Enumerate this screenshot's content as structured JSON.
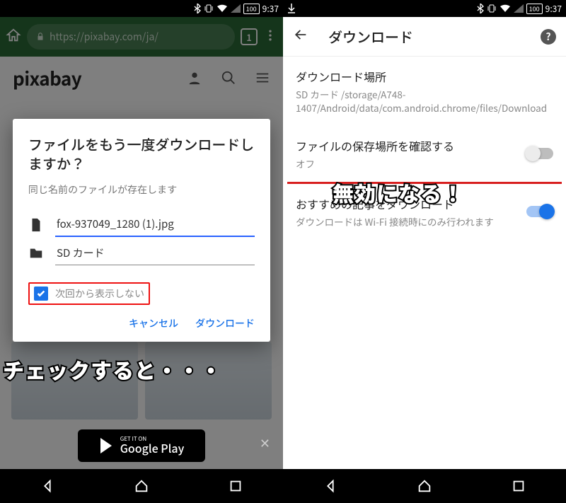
{
  "status": {
    "battery": "100",
    "time": "9:37"
  },
  "left": {
    "url": "https://pixabay.com/ja/",
    "tab_count": "1",
    "site_logo": "pixabay",
    "dialog": {
      "title": "ファイルをもう一度ダウンロードしますか？",
      "subtitle": "同じ名前のファイルが存在します",
      "filename": "fox-937049_1280 (1).jpg",
      "location": "SD カード",
      "checkbox_label": "次回から表示しない",
      "cancel": "キャンセル",
      "confirm": "ダウンロード"
    },
    "gplay_small": "GET IT ON",
    "gplay_big": "Google Play",
    "annotation": "チェックすると・・・"
  },
  "right": {
    "title": "ダウンロード",
    "item1": {
      "title": "ダウンロード場所",
      "sub": "SD カード /storage/A748-1407/Android/data/com.android.chrome/files/Download"
    },
    "item2": {
      "title": "ファイルの保存場所を確認する",
      "sub": "オフ"
    },
    "item3": {
      "title": "おすすめの記事をダウンロード",
      "sub": "ダウンロードは Wi-Fi 接続時にのみ行われます"
    },
    "annotation": "無効になる！"
  }
}
